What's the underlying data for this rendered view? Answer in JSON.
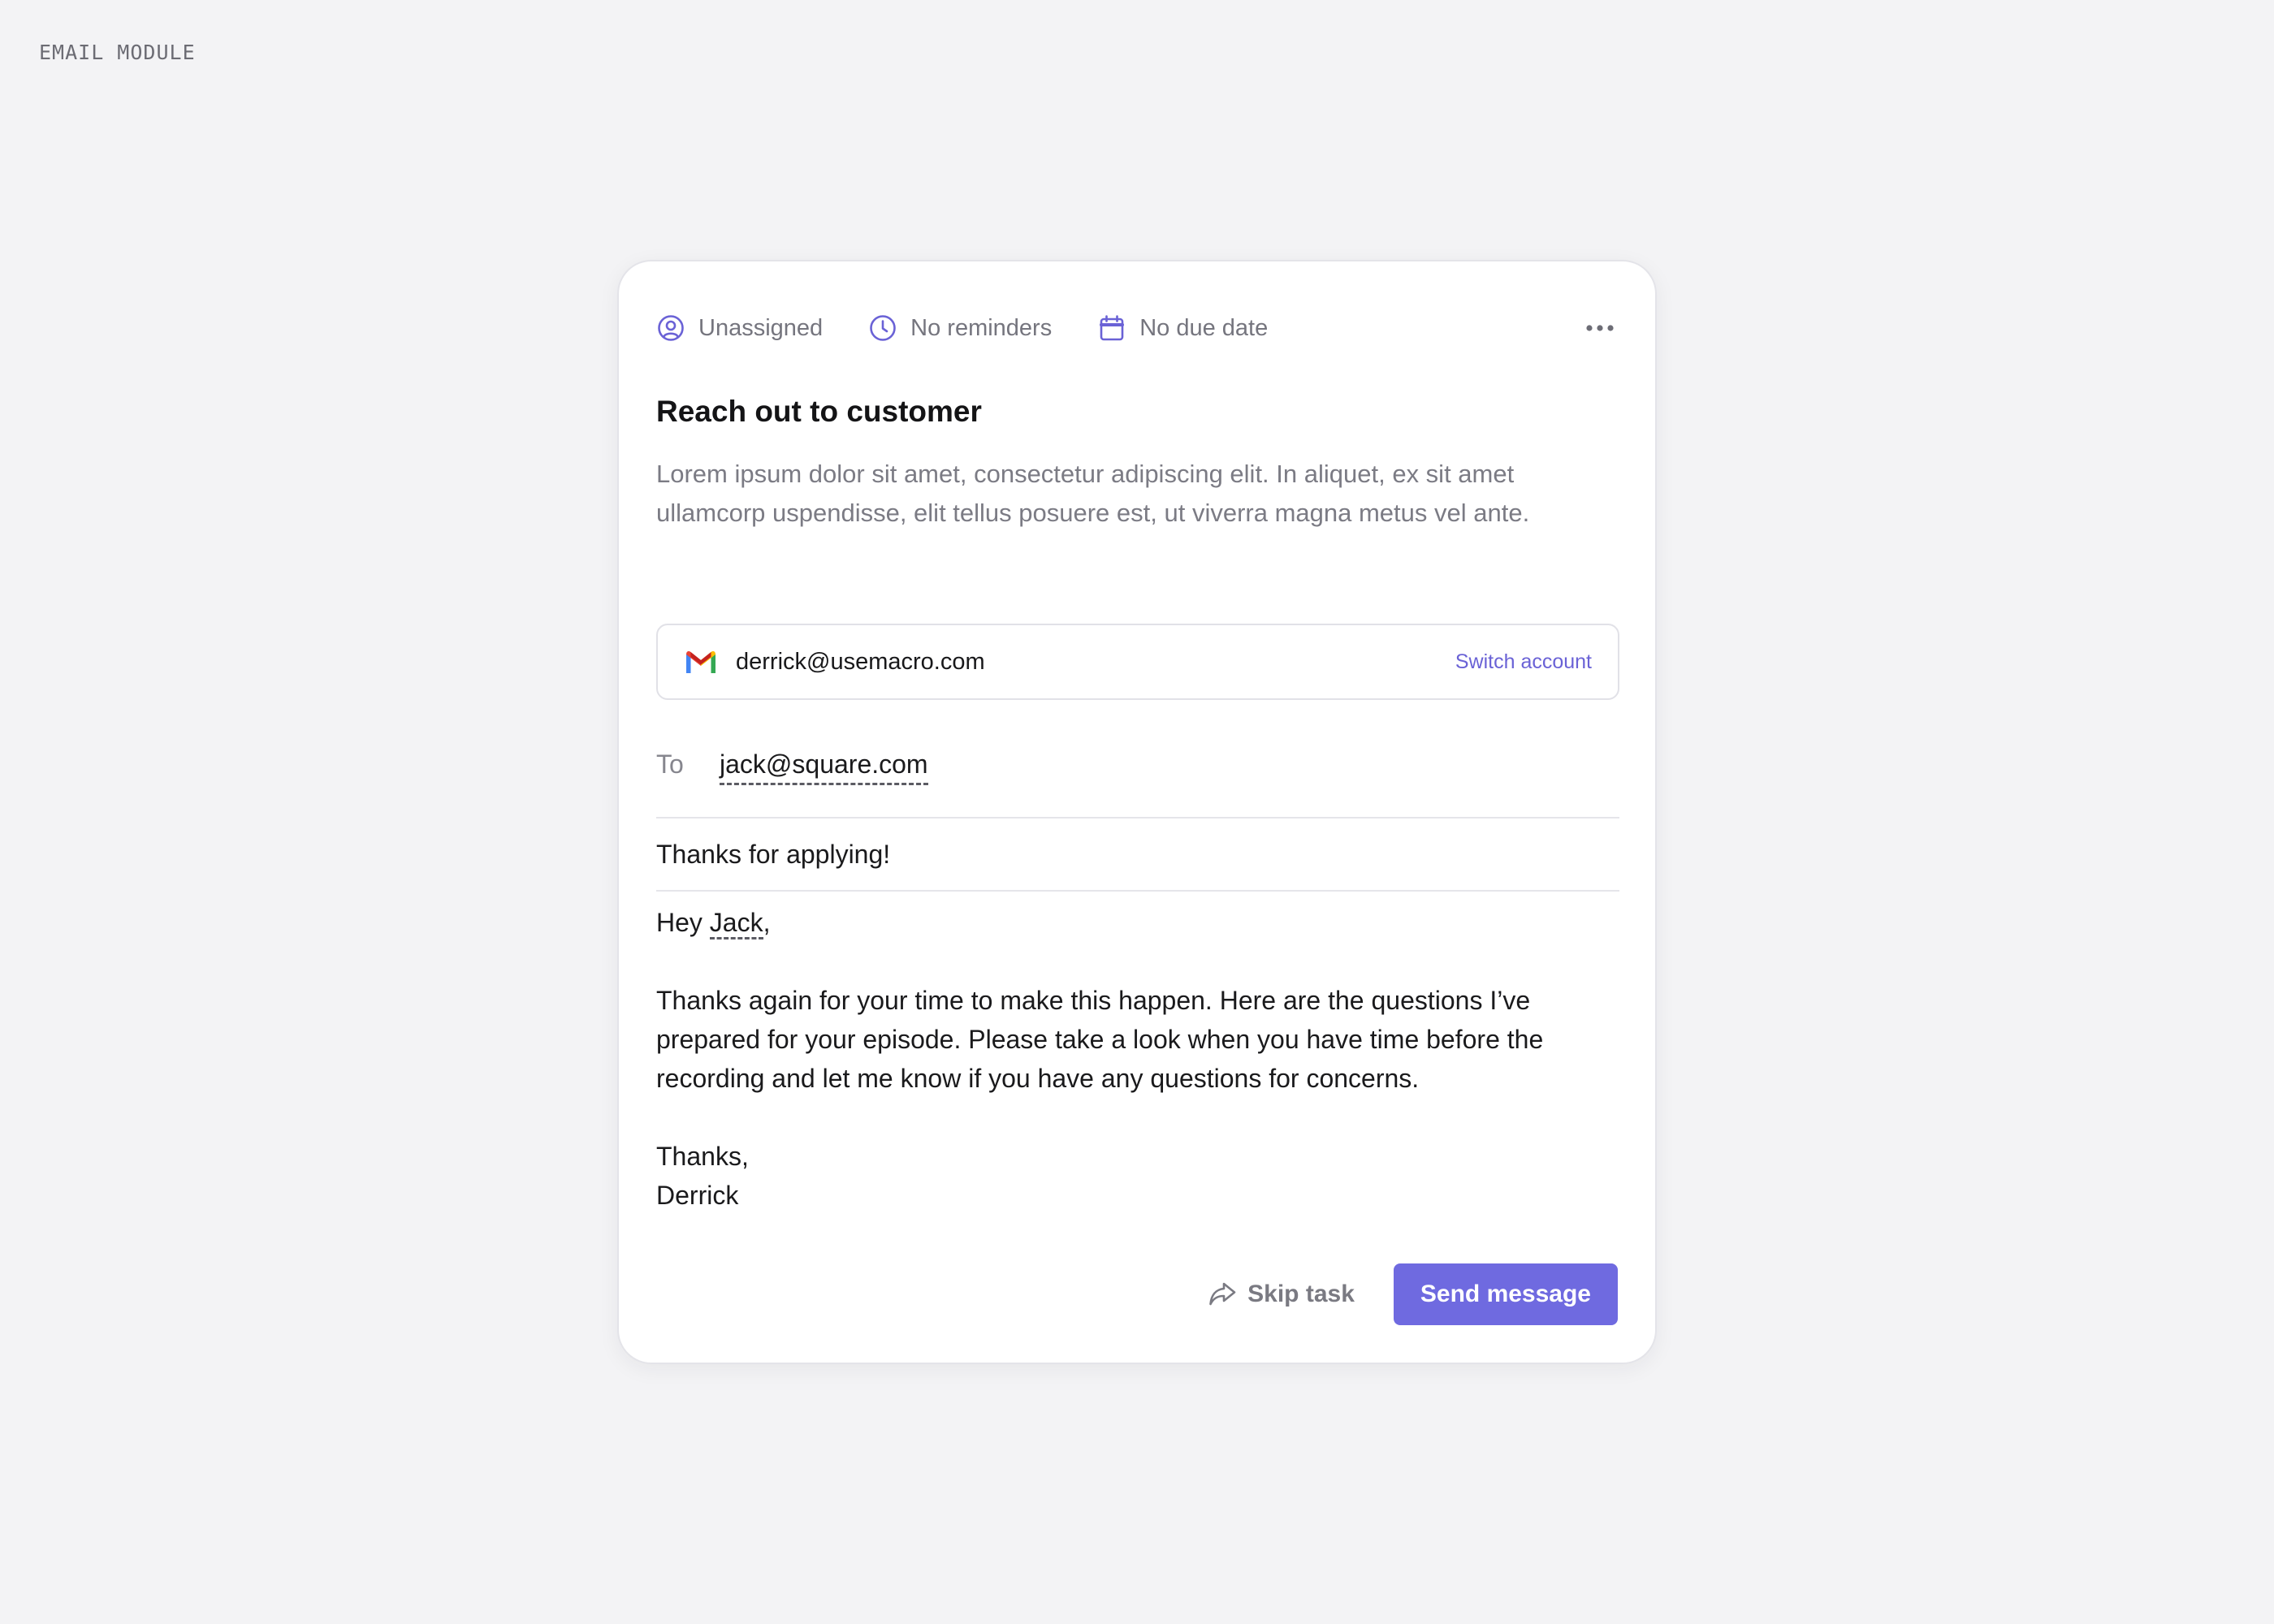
{
  "page": {
    "module_label": "EMAIL MODULE"
  },
  "colors": {
    "accent": "#6f6ae0",
    "icon_accent": "#6a62d6",
    "background": "#f3f3f5",
    "card": "#ffffff",
    "muted_text": "#75757e"
  },
  "meta": {
    "assignee": {
      "label": "Unassigned",
      "icon": "user-circle-icon"
    },
    "reminders": {
      "label": "No reminders",
      "icon": "clock-icon"
    },
    "due_date": {
      "label": "No due date",
      "icon": "calendar-icon"
    },
    "more_icon": "more-horizontal-icon"
  },
  "task": {
    "title": "Reach out to customer",
    "description": "Lorem ipsum dolor sit amet, consectetur adipiscing elit. In aliquet, ex sit amet ullamcorp uspendisse, elit tellus posuere est, ut viverra magna metus vel ante."
  },
  "account": {
    "icon": "gmail-icon",
    "email": "derrick@usemacro.com",
    "switch_label": "Switch account"
  },
  "email": {
    "to_label": "To",
    "to_value": "jack@square.com",
    "subject": "Thanks for applying!",
    "greeting_prefix": "Hey ",
    "greeting_name": "Jack",
    "greeting_suffix": ",",
    "body": "Thanks again for your time to make this happen. Here are the questions I’ve prepared for your episode. Please take a look when you have time before the recording and let me know if you have any questions for concerns.",
    "signoff": "Thanks,",
    "signature": "Derrick"
  },
  "actions": {
    "skip_label": "Skip task",
    "skip_icon": "share-forward-icon",
    "send_label": "Send message"
  }
}
